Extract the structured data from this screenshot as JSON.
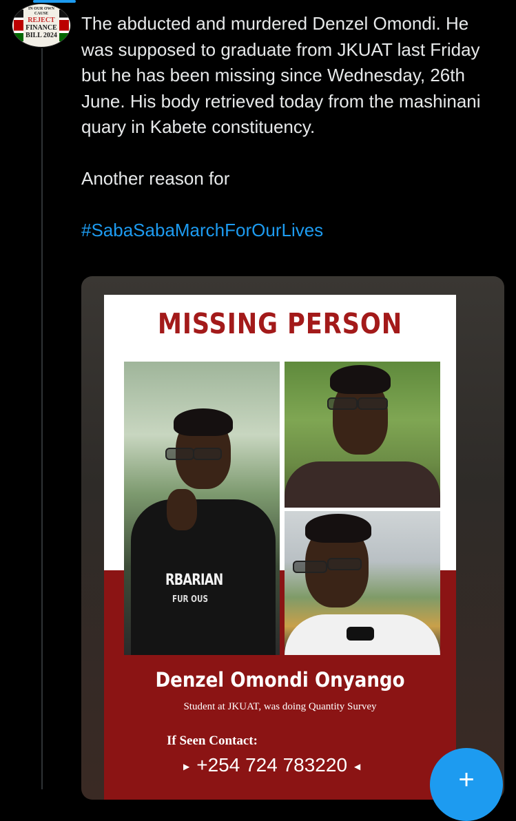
{
  "avatar": {
    "small_text": "IN OUR OWN CAUSE",
    "line1": "REJECT",
    "line2": "FINANCE",
    "line3": "BILL 2024"
  },
  "tweet": {
    "paragraph1": "The abducted and murdered Denzel Omondi. He was supposed to graduate from JKUAT last Friday but he has been missing since Wednesday, 26th June. His body retrieved today from the mashinani quary in Kabete constituency.",
    "paragraph2": "Another reason for",
    "hashtag": "#SabaSabaMarchForOurLives"
  },
  "poster": {
    "title": "MISSING PERSON",
    "hoodie_text": "RBARIAN",
    "hoodie_sub": "FUR OUS",
    "name": "Denzel Omondi Onyango",
    "subtitle": "Student at JKUAT, was doing Quantity Survey",
    "contact_label": "If Seen Contact:",
    "phone": "+254 724 783220"
  },
  "fab": {
    "icon": "plus-icon",
    "glyph": "+"
  },
  "colors": {
    "accent": "#1d9bf0",
    "poster_red": "#8b1414",
    "title_red": "#a31a1a"
  }
}
